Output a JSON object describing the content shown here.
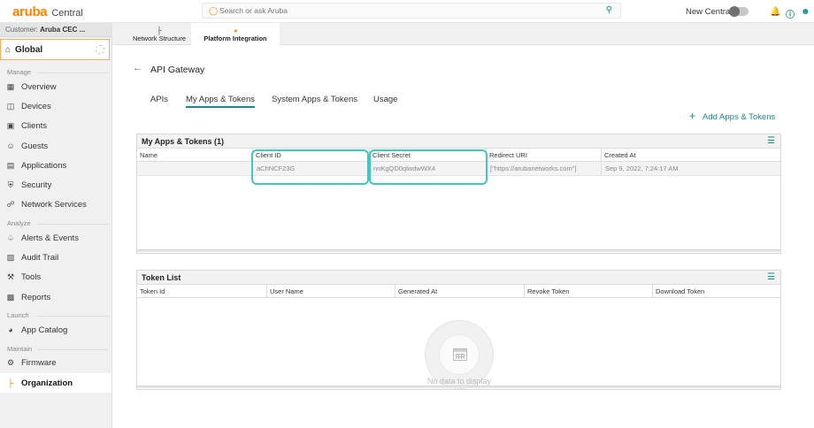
{
  "topbar": {
    "logo_brand": "aruba",
    "logo_product": "Central",
    "search_placeholder": "Search or ask Aruba",
    "new_central_label": "New Central",
    "icons": [
      "search-icon",
      "bell-icon",
      "help-icon",
      "user-icon"
    ],
    "alert_color": "#e02020"
  },
  "sidebar": {
    "customer_label": "Customer:",
    "customer_name": "Aruba CEC ...",
    "global_label": "Global",
    "sections": {
      "manage": "Manage",
      "analyze": "Analyze",
      "launch": "Launch",
      "maintain": "Maintain"
    },
    "items": [
      {
        "label": "Overview",
        "icon": "grid-icon"
      },
      {
        "label": "Devices",
        "icon": "devices-icon"
      },
      {
        "label": "Clients",
        "icon": "clients-icon"
      },
      {
        "label": "Guests",
        "icon": "guests-icon"
      },
      {
        "label": "Applications",
        "icon": "applications-icon"
      },
      {
        "label": "Security",
        "icon": "shield-icon"
      },
      {
        "label": "Network Services",
        "icon": "network-services-icon"
      },
      {
        "label": "Alerts & Events",
        "icon": "bell-icon"
      },
      {
        "label": "Audit Trail",
        "icon": "audit-icon"
      },
      {
        "label": "Tools",
        "icon": "wrench-icon"
      },
      {
        "label": "Reports",
        "icon": "reports-icon"
      },
      {
        "label": "App Catalog",
        "icon": "globe-icon"
      },
      {
        "label": "Firmware",
        "icon": "firmware-icon"
      },
      {
        "label": "Organization",
        "icon": "organization-icon",
        "active": true
      }
    ]
  },
  "page_tabs": [
    {
      "label": "Network Structure",
      "icon": "structure-icon"
    },
    {
      "label": "Platform Integration",
      "icon": "globe-icon",
      "active": true
    }
  ],
  "main": {
    "title": "API Gateway",
    "tabs": [
      "APIs",
      "My Apps & Tokens",
      "System Apps & Tokens",
      "Usage"
    ],
    "active_tab": "My Apps & Tokens",
    "add_link": "Add Apps & Tokens",
    "accent": "#1a8a8a",
    "highlight_color": "#3ec8c0"
  },
  "apps_table": {
    "title": "My Apps & Tokens (1)",
    "columns": [
      "Name",
      "Client ID",
      "Client Secret",
      "Redirect URI",
      "Created At"
    ],
    "rows": [
      [
        "",
        "aChNCF23G",
        "nnKgQD0qlwdwWX4",
        "[\"https://arubanetworks.com\"]",
        "Sep 9, 2022, 7:24:17 AM"
      ]
    ]
  },
  "token_table": {
    "title": "Token List",
    "columns": [
      "Token Id",
      "User Name",
      "Generated At",
      "Revoke Token",
      "Download Token"
    ],
    "empty_text": "No data to display"
  }
}
